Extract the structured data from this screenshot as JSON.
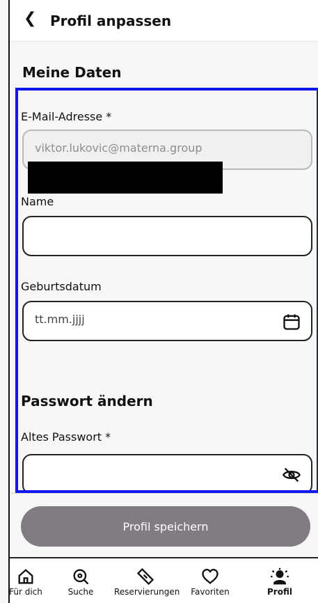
{
  "topbar": {
    "back_icon": "chevron-left-icon",
    "title": "Profil anpassen"
  },
  "personal": {
    "section_title": "Meine Daten",
    "email": {
      "label": "E-Mail-Adresse *",
      "value": "viktor.lukovic@materna.group"
    },
    "name": {
      "label": "Name",
      "value": ""
    },
    "birthdate": {
      "label": "Geburtsdatum",
      "placeholder": "tt.mm.jjjj",
      "icon": "calendar-icon"
    }
  },
  "password": {
    "section_title": "Passwort ändern",
    "old_password": {
      "label": "Altes Passwort *",
      "value": "",
      "icon": "eye-off-icon"
    }
  },
  "actions": {
    "save_label": "Profil speichern"
  },
  "tabs": [
    {
      "label": "Für dich",
      "icon": "home-icon"
    },
    {
      "label": "Suche",
      "icon": "search-icon"
    },
    {
      "label": "Reservierungen",
      "icon": "ticket-icon"
    },
    {
      "label": "Favoriten",
      "icon": "heart-icon"
    },
    {
      "label": "Profil",
      "icon": "profile-icon",
      "active": true
    }
  ],
  "colors": {
    "frame": "#1018f1",
    "button": "#817b83",
    "redaction": "#000000"
  }
}
